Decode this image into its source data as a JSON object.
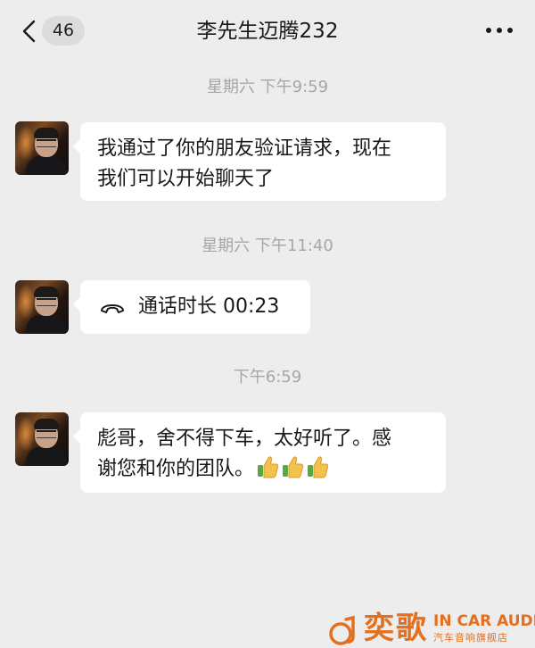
{
  "header": {
    "back_count": "46",
    "title": "李先生迈腾232"
  },
  "messages": [
    {
      "timestamp": "星期六 下午9:59",
      "lines": [
        "我通过了你的朋友验证请求，现在",
        "我们可以开始聊天了"
      ]
    },
    {
      "timestamp": "星期六 下午11:40",
      "call_text": "通话时长 00:23"
    },
    {
      "timestamp": "下午6:59",
      "lines": [
        "彪哥，舍不得下车，太好听了。感",
        "谢您和你的团队。"
      ],
      "emoji": [
        "thumbs-up",
        "thumbs-up",
        "thumbs-up"
      ]
    }
  ],
  "watermark": {
    "brand_cn": "奕歌",
    "brand_en": "IN CAR AUDIO",
    "brand_sub": "汽车音响旗舰店"
  },
  "colors": {
    "background": "#ededed",
    "bubble": "#ffffff",
    "timestamp": "#a6a6a6",
    "watermark": "#e36f1f"
  },
  "icons": [
    "back-chevron-icon",
    "more-icon",
    "phone-handset-icon",
    "thumbs-up-icon"
  ]
}
